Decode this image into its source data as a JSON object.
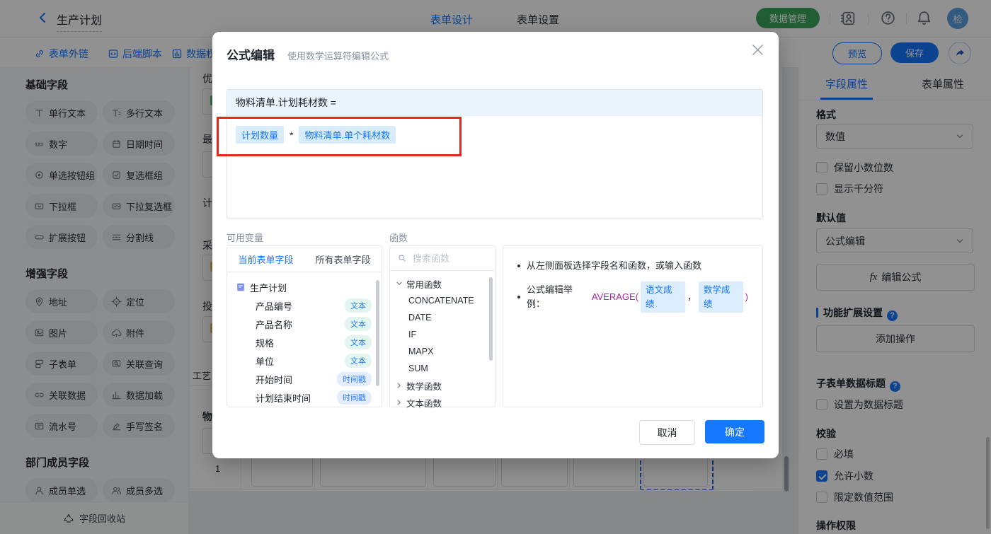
{
  "header": {
    "title": "生产计划",
    "tabs": [
      {
        "label": "表单设计"
      },
      {
        "label": "表单设置"
      }
    ],
    "data_manage": "数据管理",
    "avatar": "检"
  },
  "toolbar": {
    "items": [
      {
        "label": "表单外链",
        "icon": "link-icon"
      },
      {
        "label": "后端脚本",
        "icon": "script-icon"
      },
      {
        "label": "数据权",
        "icon": "data-permission-icon"
      }
    ],
    "preview": "预览",
    "save": "保存"
  },
  "sidebar": {
    "sections": [
      {
        "title": "基础字段",
        "fields": [
          {
            "label": "单行文本",
            "icon": "single-line-text-icon"
          },
          {
            "label": "多行文本",
            "icon": "multi-line-text-icon"
          },
          {
            "label": "数字",
            "icon": "number-icon"
          },
          {
            "label": "日期时间",
            "icon": "datetime-icon"
          },
          {
            "label": "单选按钮组",
            "icon": "radio-group-icon"
          },
          {
            "label": "复选框组",
            "icon": "checkbox-group-icon"
          },
          {
            "label": "下拉框",
            "icon": "dropdown-icon"
          },
          {
            "label": "下拉复选框",
            "icon": "multi-dropdown-icon"
          },
          {
            "label": "扩展按钮",
            "icon": "extension-button-icon"
          },
          {
            "label": "分割线",
            "icon": "divider-line-icon"
          }
        ]
      },
      {
        "title": "增强字段",
        "fields": [
          {
            "label": "地址",
            "icon": "address-icon"
          },
          {
            "label": "定位",
            "icon": "location-icon"
          },
          {
            "label": "图片",
            "icon": "image-icon"
          },
          {
            "label": "附件",
            "icon": "attachment-icon"
          },
          {
            "label": "子表单",
            "icon": "subform-icon"
          },
          {
            "label": "关联查询",
            "icon": "linked-query-icon"
          },
          {
            "label": "关联数据",
            "icon": "linked-data-icon"
          },
          {
            "label": "数据加载",
            "icon": "data-load-icon"
          },
          {
            "label": "流水号",
            "icon": "serial-number-icon"
          },
          {
            "label": "手写签名",
            "icon": "signature-icon"
          }
        ]
      },
      {
        "title": "部门成员字段",
        "fields": [
          {
            "label": "成员单选",
            "icon": "member-single-icon"
          },
          {
            "label": "成员多选",
            "icon": "member-multi-icon"
          }
        ]
      }
    ],
    "recycle": "字段回收站"
  },
  "canvas": {
    "partial_labels": [
      "优",
      "最",
      "计",
      "采",
      "投",
      "工艺",
      "物"
    ],
    "row_index": "1"
  },
  "modal": {
    "title": "公式编辑",
    "subtitle": "使用数学运算符编辑公式",
    "target": "物料清单.计划耗材数 =",
    "expr": {
      "chip1": "计划数量",
      "op": "*",
      "chip2": "物料清单.单个耗材数"
    },
    "variables": {
      "label": "可用变量",
      "tabs": [
        {
          "label": "当前表单字段"
        },
        {
          "label": "所有表单字段"
        }
      ],
      "root": "生产计划",
      "fields": [
        {
          "name": "产品编号",
          "type": "文本"
        },
        {
          "name": "产品名称",
          "type": "文本"
        },
        {
          "name": "规格",
          "type": "文本"
        },
        {
          "name": "单位",
          "type": "文本"
        },
        {
          "name": "开始时间",
          "type": "时间戳"
        },
        {
          "name": "计划结束时间",
          "type": "时间戳"
        }
      ]
    },
    "functions": {
      "label": "函数",
      "search_placeholder": "搜索函数",
      "groups": [
        {
          "name": "常用函数"
        },
        {
          "name": "数学函数"
        },
        {
          "name": "文本函数"
        }
      ],
      "common_items": [
        "CONCATENATE",
        "DATE",
        "IF",
        "MAPX",
        "SUM"
      ]
    },
    "help": {
      "line1": "从左侧面板选择字段名和函数，或输入函数",
      "line2_prefix": "公式编辑举例：",
      "fn_open": "AVERAGE(",
      "chip1": "语文成绩",
      "comma": "，",
      "chip2": "数学成绩",
      "fn_close": ")"
    },
    "cancel": "取消",
    "confirm": "确定"
  },
  "properties": {
    "tabs": [
      {
        "label": "字段属性"
      },
      {
        "label": "表单属性"
      }
    ],
    "format_label": "格式",
    "format_value": "数值",
    "decimal_checkbox": "保留小数位数",
    "thousand_checkbox": "显示千分符",
    "default_label": "默认值",
    "default_value": "公式编辑",
    "fx": "fx",
    "edit_formula": "编辑公式",
    "extension_label": "功能扩展设置",
    "add_action": "添加操作",
    "subform_title_label": "子表单数据标题",
    "subform_title_checkbox": "设置为数据标题",
    "validation_label": "校验",
    "required": "必填",
    "allow_decimal": "允许小数",
    "limit_range": "限定数值范围",
    "permission_label": "操作权限"
  },
  "colors": {
    "primary": "#1677ff",
    "green": "#3aa65c",
    "red_annotation": "#e2281e",
    "formula_header_bg": "#e9f4fd",
    "chip_bg": "#d8ecfb"
  }
}
